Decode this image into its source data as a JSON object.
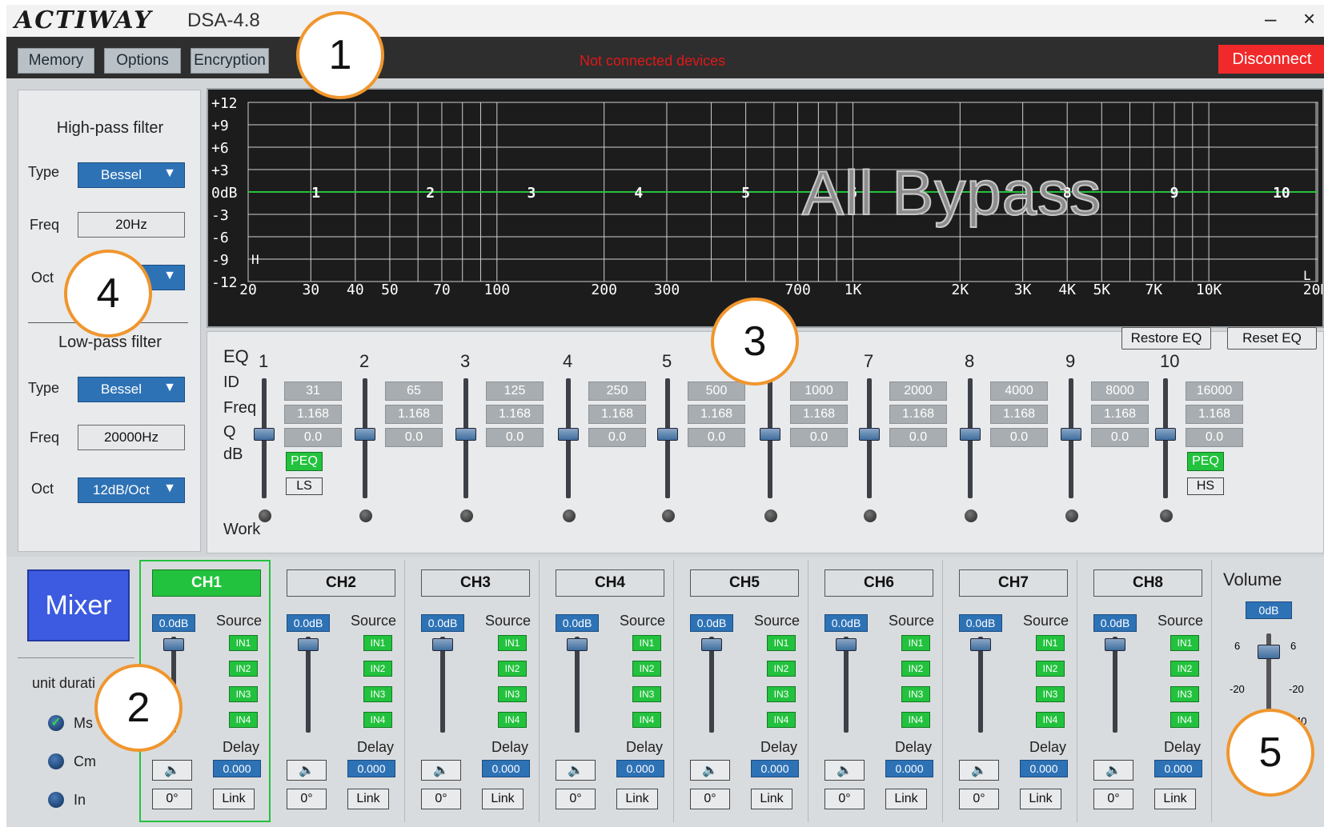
{
  "app": {
    "brand": "ACTIWAY",
    "version": "DSA-4.8",
    "minimize": "–",
    "close": "×"
  },
  "toolbar": {
    "memory": "Memory",
    "options": "Options",
    "encryption": "Encryption",
    "status": "Not connected devices",
    "disconnect": "Disconnect"
  },
  "filters": {
    "highpass": {
      "title": "High-pass filter",
      "type_label": "Type",
      "type_value": "Bessel",
      "freq_label": "Freq",
      "freq_value": "20Hz",
      "oct_label": "Oct"
    },
    "lowpass": {
      "title": "Low-pass filter",
      "type_label": "Type",
      "type_value": "Bessel",
      "freq_label": "Freq",
      "freq_value": "20000Hz",
      "oct_label": "Oct",
      "oct_value": "12dB/Oct"
    }
  },
  "graph": {
    "y_ticks": [
      "+12",
      "+9",
      "+6",
      "+3",
      "0dB",
      "-3",
      "-6",
      "-9",
      "-12"
    ],
    "x_ticks": [
      "20",
      "30",
      "40",
      "50",
      "70",
      "100",
      "200",
      "300",
      "700",
      "1K",
      "2K",
      "3K",
      "4K",
      "5K",
      "7K",
      "10K",
      "20K"
    ],
    "band_markers": [
      "1",
      "2",
      "3",
      "4",
      "5",
      "6",
      "7",
      "8",
      "9",
      "10"
    ],
    "overlay": "All Bypass",
    "hp_marker": "H",
    "lp_marker": "L"
  },
  "eq": {
    "title": "EQ",
    "labels": {
      "id": "ID",
      "freq": "Freq",
      "q": "Q",
      "db": "dB",
      "work": "Work"
    },
    "restore": "Restore EQ",
    "reset": "Reset EQ",
    "bands": [
      {
        "id": "1",
        "freq": "31",
        "q": "1.168",
        "db": "0.0",
        "type": "PEQ",
        "shelf": "LS"
      },
      {
        "id": "2",
        "freq": "65",
        "q": "1.168",
        "db": "0.0"
      },
      {
        "id": "3",
        "freq": "125",
        "q": "1.168",
        "db": "0.0"
      },
      {
        "id": "4",
        "freq": "250",
        "q": "1.168",
        "db": "0.0"
      },
      {
        "id": "5",
        "freq": "500",
        "q": "1.168",
        "db": "0.0"
      },
      {
        "id": "6",
        "freq": "1000",
        "q": "1.168",
        "db": "0.0"
      },
      {
        "id": "7",
        "freq": "2000",
        "q": "1.168",
        "db": "0.0"
      },
      {
        "id": "8",
        "freq": "4000",
        "q": "1.168",
        "db": "0.0"
      },
      {
        "id": "9",
        "freq": "8000",
        "q": "1.168",
        "db": "0.0"
      },
      {
        "id": "10",
        "freq": "16000",
        "q": "1.168",
        "db": "0.0",
        "type": "PEQ",
        "shelf": "HS"
      }
    ]
  },
  "mixer": {
    "button": "Mixer",
    "unit_label": "unit durati",
    "units": [
      "Ms",
      "Cm",
      "In"
    ],
    "source_label": "Source",
    "delay_label": "Delay",
    "inputs": [
      "IN1",
      "IN2",
      "IN3",
      "IN4"
    ],
    "phase": "0°",
    "link": "Link",
    "mute_icon": "speaker-icon",
    "channels": [
      {
        "name": "CH1",
        "gain": "0.0dB",
        "delay": "0.000",
        "active": true
      },
      {
        "name": "CH2",
        "gain": "0.0dB",
        "delay": "0.000"
      },
      {
        "name": "CH3",
        "gain": "0.0dB",
        "delay": "0.000"
      },
      {
        "name": "CH4",
        "gain": "0.0dB",
        "delay": "0.000"
      },
      {
        "name": "CH5",
        "gain": "0.0dB",
        "delay": "0.000"
      },
      {
        "name": "CH6",
        "gain": "0.0dB",
        "delay": "0.000"
      },
      {
        "name": "CH7",
        "gain": "0.0dB",
        "delay": "0.000"
      },
      {
        "name": "CH8",
        "gain": "0.0dB",
        "delay": "0.000"
      }
    ]
  },
  "volume": {
    "title": "Volume",
    "value": "0dB",
    "scale": [
      "6",
      "-20",
      "40"
    ]
  },
  "callouts": [
    "1",
    "2",
    "3",
    "4",
    "5"
  ],
  "colors": {
    "accent_blue": "#2e72b6",
    "active_green": "#23c23e",
    "alert_red": "#f02a2a",
    "callout_orange": "#f0962e"
  }
}
